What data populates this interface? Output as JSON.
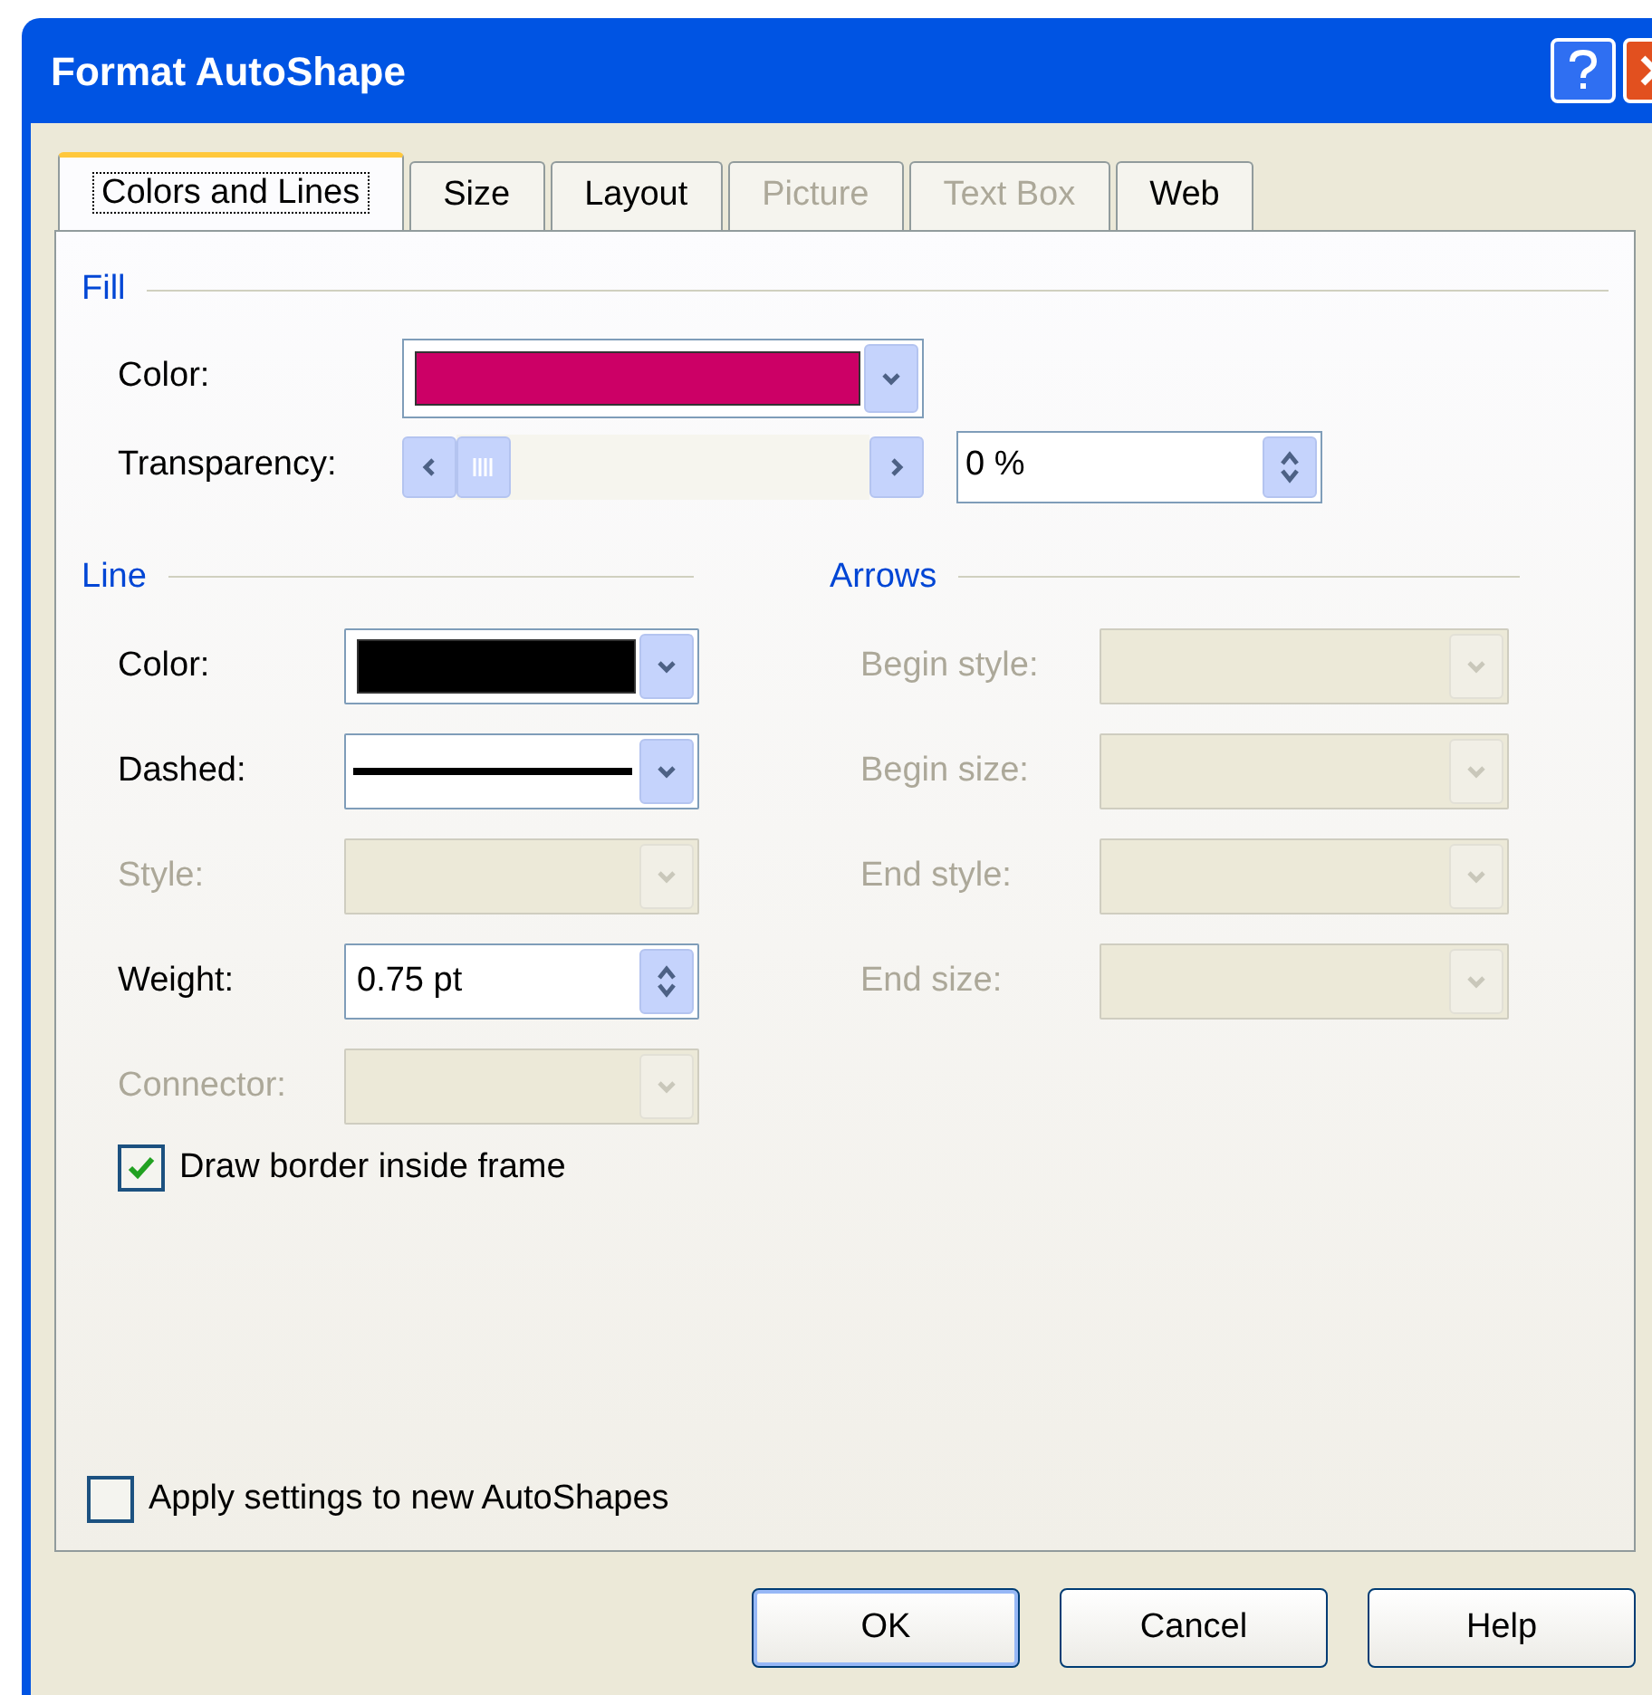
{
  "window": {
    "title": "Format AutoShape"
  },
  "tabs": [
    {
      "label": "Colors and Lines",
      "selected": true,
      "disabled": false
    },
    {
      "label": "Size",
      "selected": false,
      "disabled": false
    },
    {
      "label": "Layout",
      "selected": false,
      "disabled": false
    },
    {
      "label": "Picture",
      "selected": false,
      "disabled": true
    },
    {
      "label": "Text Box",
      "selected": false,
      "disabled": true
    },
    {
      "label": "Web",
      "selected": false,
      "disabled": false
    }
  ],
  "fill": {
    "title": "Fill",
    "color": {
      "label": "Color:",
      "color": "#cc0066"
    },
    "transparency": {
      "label": "Transparency:",
      "level": 0,
      "value": "0 %"
    }
  },
  "line": {
    "title": "Line",
    "fields": [
      {
        "label": "Color:",
        "kind": "color",
        "color": "#000000",
        "disabled": false
      },
      {
        "label": "Dashed:",
        "kind": "dash",
        "disabled": false
      },
      {
        "label": "Style:",
        "kind": "select",
        "disabled": true
      },
      {
        "label": "Weight:",
        "kind": "spin",
        "value": "0.75 pt",
        "disabled": false
      },
      {
        "label": "Connector:",
        "kind": "select",
        "disabled": true
      }
    ]
  },
  "arrows": {
    "title": "Arrows",
    "fields": [
      {
        "label": "Begin style:",
        "kind": "select",
        "disabled": true
      },
      {
        "label": "Begin size:",
        "kind": "select",
        "disabled": true
      },
      {
        "label": "End style:",
        "kind": "select",
        "disabled": true
      },
      {
        "label": "End size:",
        "kind": "select",
        "disabled": true
      }
    ]
  },
  "draw_border_inside_frame": {
    "label": "Draw border inside frame",
    "checked": true
  },
  "apply_to_new": {
    "label": "Apply settings to new AutoShapes",
    "checked": false
  },
  "buttons": [
    {
      "label": "OK",
      "default": true
    },
    {
      "label": "Cancel",
      "default": false
    },
    {
      "label": "Help",
      "default": false
    }
  ]
}
